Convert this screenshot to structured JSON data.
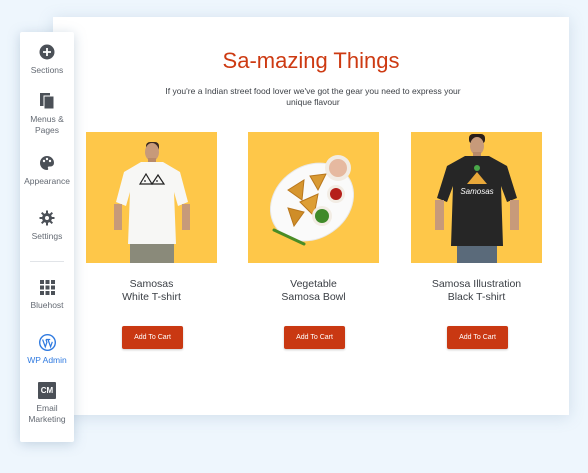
{
  "sidebar": {
    "items": [
      {
        "label": "Sections",
        "icon": "plus-circle-icon"
      },
      {
        "label": "Menus &\nPages",
        "icon": "pages-icon"
      },
      {
        "label": "Appearance",
        "icon": "palette-icon"
      },
      {
        "label": "Settings",
        "icon": "gear-icon"
      },
      {
        "label": "Bluehost",
        "icon": "grid-icon"
      },
      {
        "label": "WP Admin",
        "icon": "wordpress-icon"
      },
      {
        "label": "Email\nMarketing",
        "icon": "cm-icon",
        "badge": "CM"
      }
    ],
    "active_color": "#2f7ae0"
  },
  "page": {
    "title": "Sa-mazing Things",
    "subtitle": "If you're a Indian street food lover we've got the gear you need to express your unique flavour",
    "accent": "#cd3a12",
    "image_bg": "#fec749"
  },
  "products": [
    {
      "name": "Samosas\nWhite T-shirt",
      "button": "Add To Cart",
      "image": "white-tshirt"
    },
    {
      "name": "Vegetable\nSamosa Bowl",
      "button": "Add To Cart",
      "image": "samosa-bowl"
    },
    {
      "name": "Samosa Illustration\nBlack T-shirt",
      "button": "Add To Cart",
      "image": "black-tshirt",
      "shirt_text": "Samosas"
    }
  ]
}
